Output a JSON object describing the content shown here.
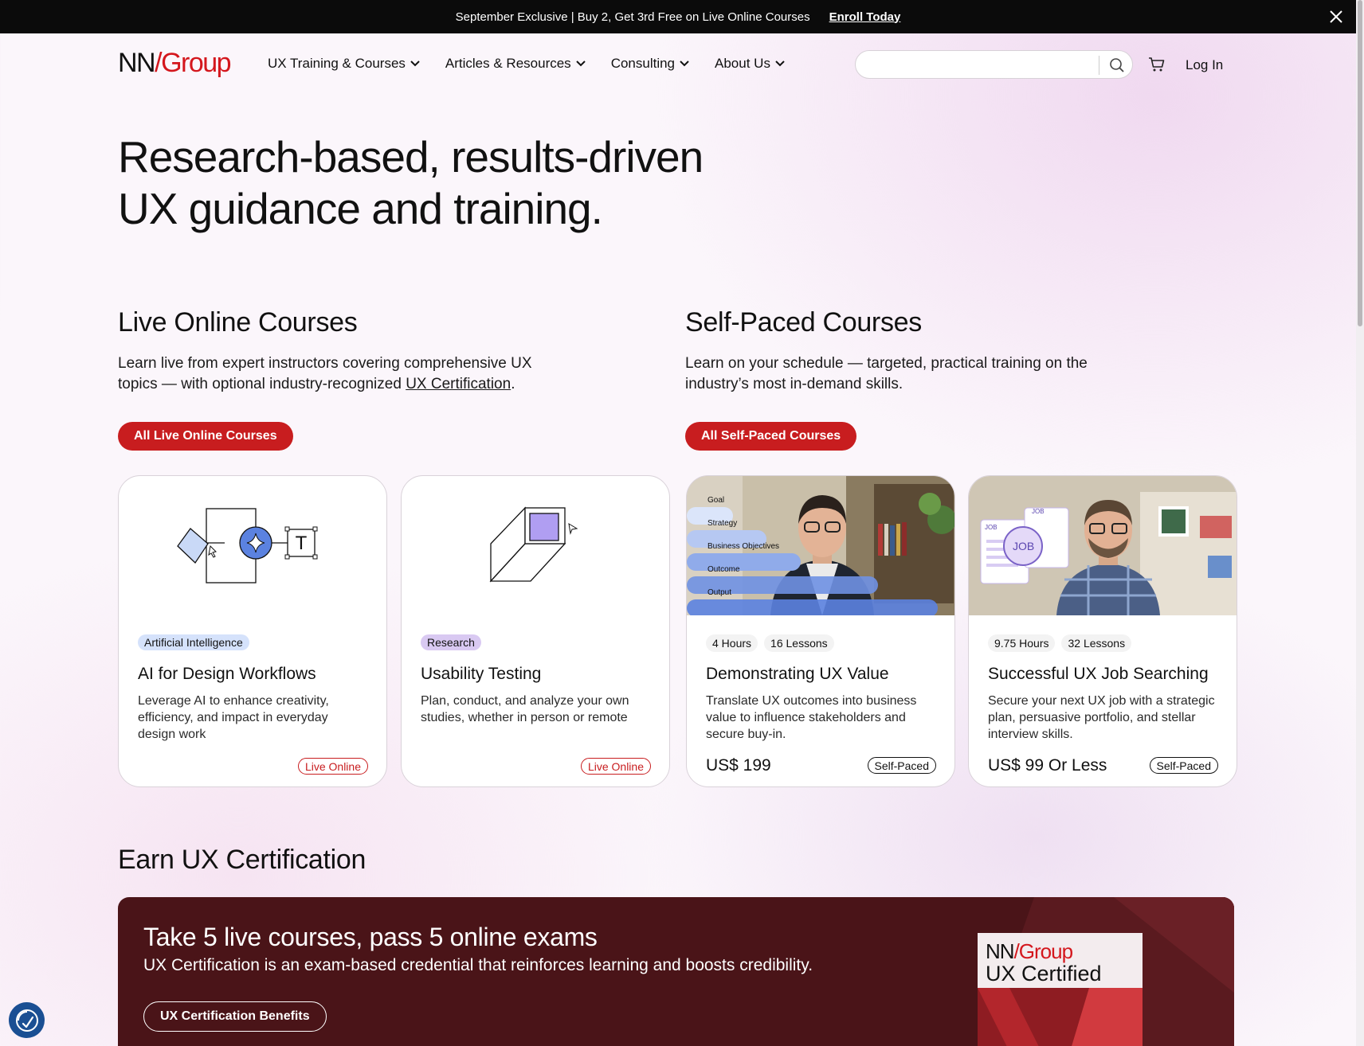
{
  "promo": {
    "text": "September Exclusive | Buy 2, Get 3rd Free on Live Online Courses",
    "link": "Enroll Today"
  },
  "header": {
    "logo_nn": "NN",
    "logo_slash": "/",
    "logo_group": "Group",
    "nav": [
      {
        "label": "UX Training & Courses"
      },
      {
        "label": "Articles & Resources"
      },
      {
        "label": "Consulting"
      },
      {
        "label": "About Us"
      }
    ],
    "search_placeholder": "",
    "login": "Log In"
  },
  "hero": {
    "line1": "Research-based, results-driven",
    "line2": "UX guidance and training."
  },
  "live": {
    "title": "Live Online Courses",
    "desc_before": "Learn live from expert instructors covering comprehensive UX topics — with optional industry-recognized ",
    "desc_link": "UX Certification",
    "desc_after": ".",
    "button": "All Live Online Courses"
  },
  "self": {
    "title": "Self-Paced Courses",
    "desc": "Learn on your schedule — targeted, practical training on the industry’s most in-demand skills.",
    "button": "All Self-Paced Courses"
  },
  "cards": [
    {
      "tag": "Artificial Intelligence",
      "title": "AI for Design Workflows",
      "desc": "Leverage AI to enhance creativity, efficiency, and impact in everyday design work",
      "badge": "Live Online",
      "illus_letter": "T"
    },
    {
      "tag": "Research",
      "title": "Usability Testing",
      "desc": "Plan, conduct, and analyze your own studies, whether in person or remote",
      "badge": "Live Online"
    },
    {
      "hours": "4 Hours",
      "lessons": "16 Lessons",
      "title": "Demonstrating UX Value",
      "desc": "Translate UX outcomes into business value to influence stakeholders and secure buy-in.",
      "price": "US$ 199",
      "badge": "Self-Paced",
      "photo_labels": [
        "Goal",
        "Strategy",
        "Business Objectives",
        "Outcome",
        "Output"
      ]
    },
    {
      "hours": "9.75 Hours",
      "lessons": "32 Lessons",
      "title": "Successful UX Job Searching",
      "desc": "Secure your next UX job with a strategic plan, persuasive portfolio, and stellar interview skills.",
      "price": "US$ 99 Or Less",
      "badge": "Self-Paced",
      "photo_labels": [
        "JOB",
        "JOB",
        "JOB"
      ]
    }
  ],
  "cert": {
    "section_title": "Earn UX Certification",
    "heading": "Take 5 live courses, pass 5 online exams",
    "sub": "UX Certification is an exam-based credential that reinforces learning and boosts credibility.",
    "button": "UX Certification Benefits",
    "badge_nn": "NN",
    "badge_group": "/Group",
    "badge_line2": "UX Certified"
  },
  "colors": {
    "brand_red": "#c81d1f",
    "cert_bg": "#4a1418"
  }
}
